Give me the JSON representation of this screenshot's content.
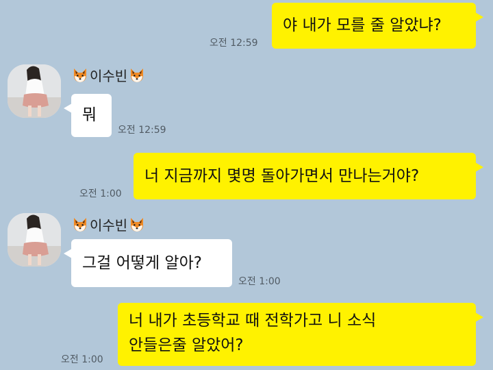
{
  "colors": {
    "background": "#b2c7d9",
    "my_bubble": "#fff200",
    "their_bubble": "#ffffff"
  },
  "contact": {
    "name": "이수빈",
    "emoji_icon": "fox-face-icon"
  },
  "messages": [
    {
      "from": "me",
      "text": "야 내가 모를 줄 알았냐?",
      "time": "오전 12:59"
    },
    {
      "from": "them",
      "text": "뭐",
      "time": "오전 12:59"
    },
    {
      "from": "me",
      "text": "너 지금까지 몇명 돌아가면서 만나는거야?",
      "time": "오전 1:00"
    },
    {
      "from": "them",
      "text": "그걸 어떻게 알아?",
      "time": "오전 1:00"
    },
    {
      "from": "me",
      "text_lines": [
        "너 내가 초등학교 때 전학가고 니 소식",
        "안들은줄 알았어?"
      ],
      "time": "오전 1:00"
    }
  ]
}
